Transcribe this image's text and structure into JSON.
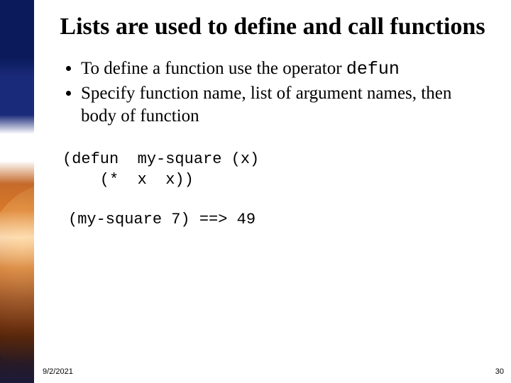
{
  "slide": {
    "title": "Lists are used to define and call functions",
    "bullets": [
      {
        "text_before": "To define a function use the operator ",
        "code": "defun",
        "text_after": ""
      },
      {
        "text_before": "Specify function name, list of argument names, then body of function",
        "code": "",
        "text_after": ""
      }
    ],
    "code": "(defun  my-square (x)\n    (*  x  x))",
    "result": "(my-square 7) ==> 49"
  },
  "footer": {
    "date": "9/2/2021",
    "page": "30"
  }
}
